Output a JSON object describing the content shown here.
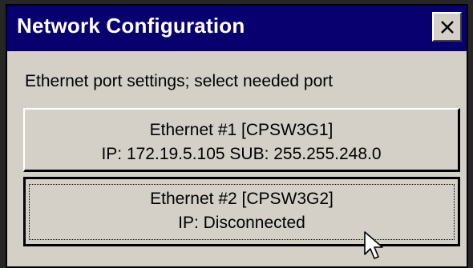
{
  "dialog": {
    "title": "Network Configuration",
    "close_label": "close"
  },
  "instructions": "Ethernet port settings; select needed port",
  "ports": [
    {
      "name": "Ethernet #1 [CPSW3G1]",
      "detail": "IP: 172.19.5.105  SUB: 255.255.248.0"
    },
    {
      "name": "Ethernet #2 [CPSW3G2]",
      "detail": "IP: Disconnected"
    }
  ]
}
